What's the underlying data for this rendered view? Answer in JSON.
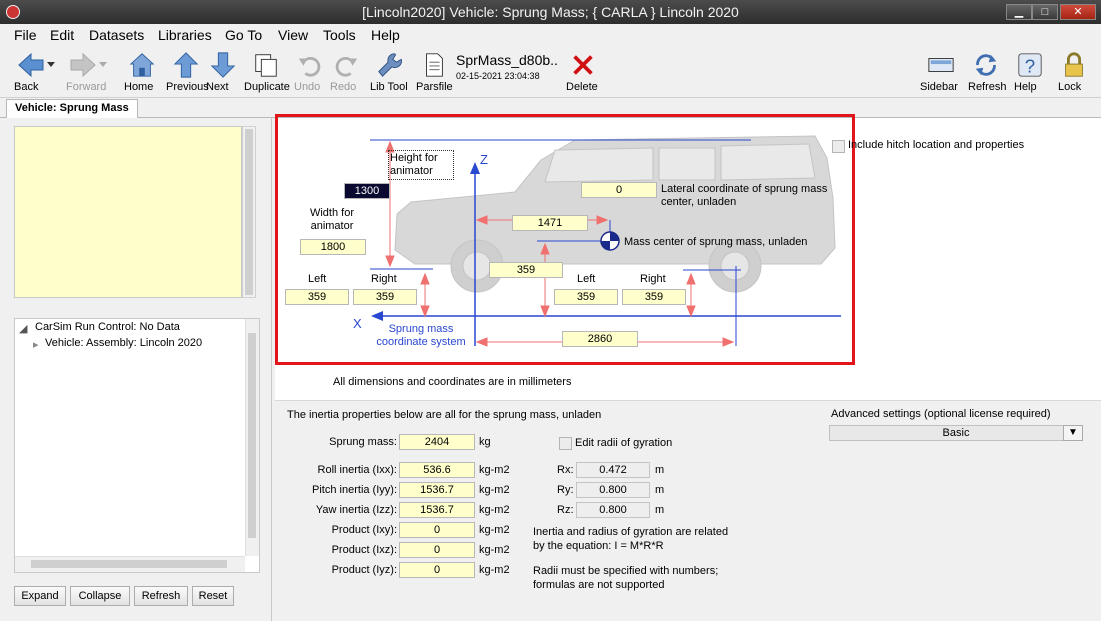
{
  "window": {
    "title": "[Lincoln2020] Vehicle: Sprung Mass; { CARLA } Lincoln 2020",
    "minimize": "▁",
    "maximize": "□",
    "close": "✕"
  },
  "menu": [
    "File",
    "Edit",
    "Datasets",
    "Libraries",
    "Go To",
    "View",
    "Tools",
    "Help"
  ],
  "toolbar": {
    "back": "Back",
    "forward": "Forward",
    "home": "Home",
    "previous": "Previous",
    "next": "Next",
    "duplicate": "Duplicate",
    "undo": "Undo",
    "redo": "Redo",
    "lib_tool": "Lib Tool",
    "parsfile": "Parsfile",
    "delete": "Delete",
    "sidebar": "Sidebar",
    "refresh": "Refresh",
    "help": "Help",
    "lock": "Lock",
    "dataset_name": "SprMass_d80b..",
    "dataset_date": "02-15-2021 23:04:38"
  },
  "tab": "Vehicle: Sprung Mass",
  "tree": {
    "root": "CarSim Run Control: No Data",
    "child": "Vehicle: Assembly: Lincoln 2020"
  },
  "left_buttons": {
    "expand": "Expand",
    "collapse": "Collapse",
    "refresh": "Refresh",
    "reset": "Reset"
  },
  "diagram": {
    "height_label": "Height for animator",
    "height_value": "1300",
    "width_label": "Width for animator",
    "width_value": "1800",
    "z_axis": "Z",
    "x_axis": "X",
    "lateral_value": "0",
    "lateral_label": "Lateral coordinate of sprung mass center, unladen",
    "cg_x_value": "1471",
    "cg_label": "Mass center of sprung mass, unladen",
    "cg_height_value": "359",
    "front_left_label": "Left",
    "front_right_label": "Right",
    "front_left_value": "359",
    "front_right_value": "359",
    "rear_left_label": "Left",
    "rear_right_label": "Right",
    "rear_left_value": "359",
    "rear_right_value": "359",
    "coord_label": "Sprung mass coordinate system",
    "wheelbase_value": "2860",
    "hitch_label": "Include hitch location and properties",
    "units_note": "All dimensions and coordinates are in millimeters"
  },
  "inertia": {
    "heading": "The inertia properties below are all for the sprung mass, unladen",
    "rows": [
      {
        "label": "Sprung mass:",
        "value": "2404",
        "unit": "kg"
      },
      {
        "label": "Roll inertia (Ixx):",
        "value": "536.6",
        "unit": "kg-m2"
      },
      {
        "label": "Pitch inertia (Iyy):",
        "value": "1536.7",
        "unit": "kg-m2"
      },
      {
        "label": "Yaw inertia (Izz):",
        "value": "1536.7",
        "unit": "kg-m2"
      },
      {
        "label": "Product (Ixy):",
        "value": "0",
        "unit": "kg-m2"
      },
      {
        "label": "Product (Ixz):",
        "value": "0",
        "unit": "kg-m2"
      },
      {
        "label": "Product (Iyz):",
        "value": "0",
        "unit": "kg-m2"
      }
    ],
    "edit_radii_label": "Edit radii of gyration",
    "radii": [
      {
        "label": "Rx:",
        "value": "0.472",
        "unit": "m"
      },
      {
        "label": "Ry:",
        "value": "0.800",
        "unit": "m"
      },
      {
        "label": "Rz:",
        "value": "0.800",
        "unit": "m"
      }
    ],
    "note1": "Inertia and radius of gyration are related by the equation: I = M*R*R",
    "note2": "Radii must be specified with numbers; formulas are not supported"
  },
  "advanced": {
    "label": "Advanced settings (optional license required)",
    "value": "Basic"
  }
}
